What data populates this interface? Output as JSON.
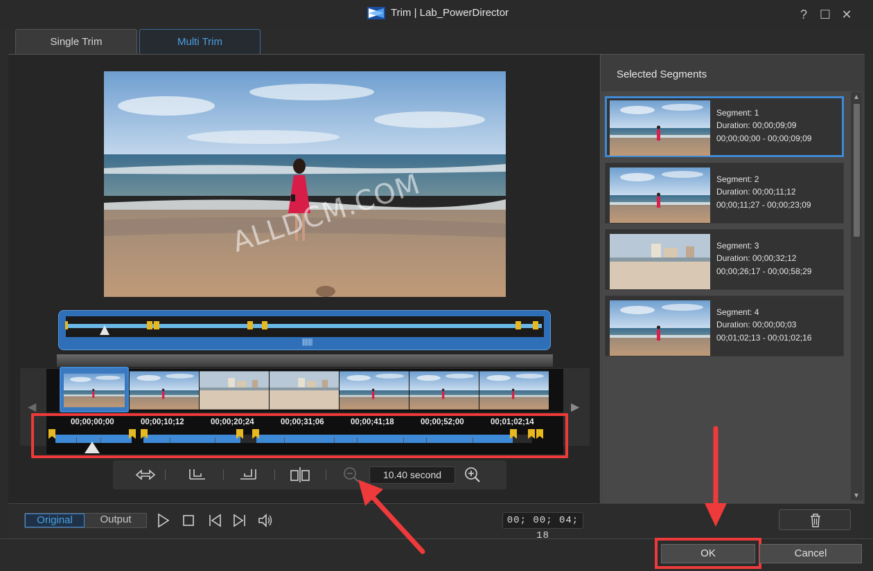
{
  "window": {
    "title": "Trim | Lab_PowerDirector",
    "help_glyph": "?",
    "maximize_glyph": "☐",
    "close_glyph": "✕"
  },
  "tabs": [
    {
      "label": "Single Trim",
      "active": false
    },
    {
      "label": "Multi Trim",
      "active": true
    }
  ],
  "preview": {
    "watermark": "ALLDCM.COM"
  },
  "timeline": {
    "timecodes": [
      "00;00;00;00",
      "00;00;10;12",
      "00;00;20;24",
      "00;00;31;06",
      "00;00;41;18",
      "00;00;52;00",
      "00;01;02;14"
    ],
    "zoom_value": "10.40 second"
  },
  "playback": {
    "original_label": "Original",
    "output_label": "Output",
    "timecode": "00; 00; 04; 18"
  },
  "segments_panel": {
    "title": "Selected Segments",
    "segments": [
      {
        "name": "Segment: 1",
        "duration": "Duration: 00;00;09;09",
        "range": "00;00;00;00 - 00;00;09;09",
        "selected": true
      },
      {
        "name": "Segment: 2",
        "duration": "Duration: 00;00;11;12",
        "range": "00;00;11;27 - 00;00;23;09",
        "selected": false
      },
      {
        "name": "Segment: 3",
        "duration": "Duration: 00;00;32;12",
        "range": "00;00;26;17 - 00;00;58;29",
        "selected": false
      },
      {
        "name": "Segment: 4",
        "duration": "Duration: 00;00;00;03",
        "range": "00;01;02;13 - 00;01;02;16",
        "selected": false
      }
    ]
  },
  "footer": {
    "ok_label": "OK",
    "cancel_label": "Cancel"
  },
  "colors": {
    "accent": "#3f8ad6",
    "highlight": "#ee3a3a",
    "marker": "#e8b820"
  }
}
